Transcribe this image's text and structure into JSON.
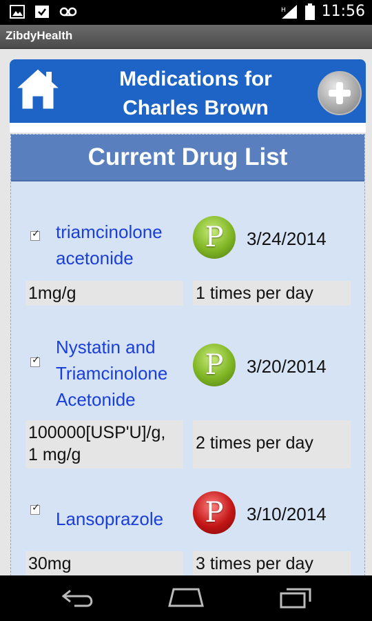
{
  "status_bar": {
    "time": "11:56",
    "left_icons": [
      "image-icon",
      "check-icon",
      "voicemail-icon"
    ],
    "right_icons": [
      "signal-icon",
      "battery-icon"
    ]
  },
  "app": {
    "title": "ZibdyHealth"
  },
  "header": {
    "title_line1": "Medications for",
    "title_line2": "Charles Brown",
    "home_icon": "home-icon",
    "add_icon": "add-icon"
  },
  "section": {
    "title": "Current Drug List"
  },
  "drugs": [
    {
      "name_line1": "triamcinolone",
      "name_line2": "acetonide",
      "name_line3": "",
      "checked": true,
      "pill_letter": "P",
      "pill_color": "#7fb524",
      "date": "3/24/2014",
      "dose_line1": "1mg/g",
      "dose_line2": "",
      "frequency": "1 times per day"
    },
    {
      "name_line1": "Nystatin and",
      "name_line2": "Triamcinolone",
      "name_line3": "Acetonide",
      "checked": true,
      "pill_letter": "P",
      "pill_color": "#7fb524",
      "date": "3/20/2014",
      "dose_line1": "100000[USP'U]/g,",
      "dose_line2": "1 mg/g",
      "frequency": "2 times per day"
    },
    {
      "name_line1": "Lansoprazole",
      "name_line2": "",
      "name_line3": "",
      "checked": true,
      "pill_letter": "P",
      "pill_color": "#c31515",
      "date": "3/10/2014",
      "dose_line1": "30mg",
      "dose_line2": "",
      "frequency": "3 times per day"
    }
  ],
  "nav_bar": {
    "back_icon": "back-icon",
    "home_icon": "nav-home-icon",
    "recents_icon": "recent-apps-icon"
  }
}
